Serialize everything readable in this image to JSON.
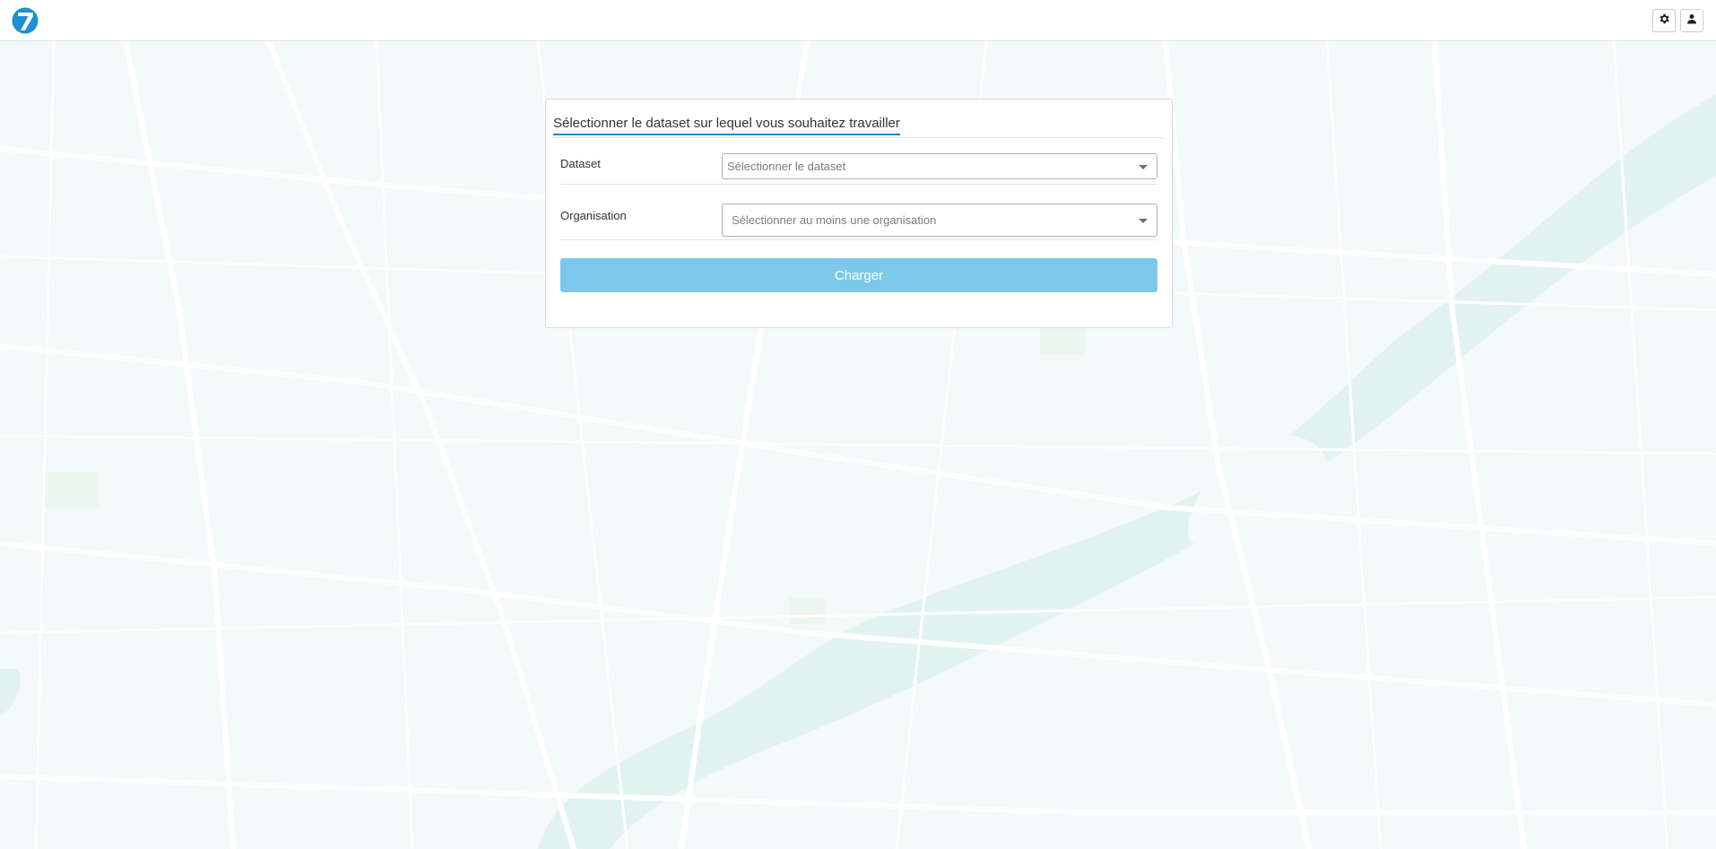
{
  "header": {
    "logo_icon": "seven-logo-icon",
    "brand_color": "#1e8fd0",
    "buttons": [
      {
        "icon": "gear-icon"
      },
      {
        "icon": "user-icon"
      }
    ]
  },
  "panel": {
    "title": "Sélectionner le dataset sur lequel vous souhaitez travailler",
    "fields": {
      "dataset": {
        "label": "Dataset",
        "placeholder": "Sélectionner le dataset"
      },
      "organisation": {
        "label": "Organisation",
        "placeholder": "Sélectionner au moins une organisation"
      }
    },
    "load_button": "Charger"
  },
  "colors": {
    "accent": "#1e88c6",
    "button_bg": "#7cc8ea",
    "map_bg": "#f4f9f9",
    "map_water": "#e3f3f2"
  }
}
